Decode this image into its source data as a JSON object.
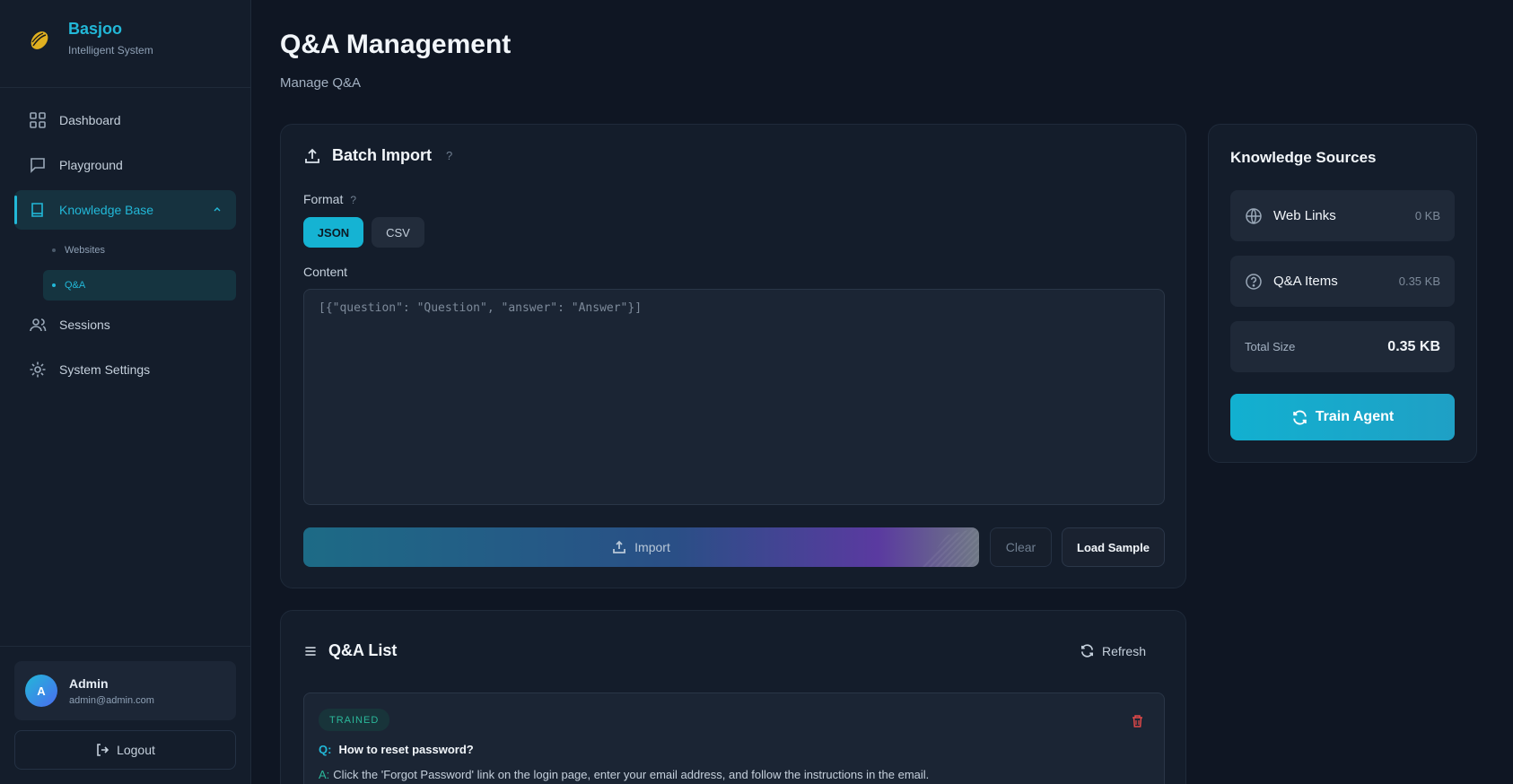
{
  "brand": {
    "name": "Basjoo",
    "subtitle": "Intelligent System"
  },
  "sidebar": {
    "items": [
      {
        "label": "Dashboard",
        "icon": "grid-icon"
      },
      {
        "label": "Playground",
        "icon": "chat-icon"
      },
      {
        "label": "Knowledge Base",
        "icon": "book-icon",
        "active": true,
        "expanded": true,
        "children": [
          {
            "label": "Websites"
          },
          {
            "label": "Q&A",
            "active": true
          }
        ]
      },
      {
        "label": "Sessions",
        "icon": "users-icon"
      },
      {
        "label": "System Settings",
        "icon": "gear-icon"
      }
    ],
    "user": {
      "initial": "A",
      "name": "Admin",
      "email": "admin@admin.com"
    },
    "logout_label": "Logout"
  },
  "page": {
    "title": "Q&A Management",
    "subtitle": "Manage Q&A"
  },
  "batch_import": {
    "title": "Batch Import",
    "help": "?",
    "format_label": "Format",
    "format_help": "?",
    "formats": [
      "JSON",
      "CSV"
    ],
    "selected_format": "JSON",
    "content_label": "Content",
    "content_placeholder": "[{\"question\": \"Question\", \"answer\": \"Answer\"}]",
    "content_value": "",
    "import_label": "Import",
    "clear_label": "Clear",
    "load_sample_label": "Load Sample"
  },
  "qa_list": {
    "title": "Q&A List",
    "refresh_label": "Refresh",
    "items": [
      {
        "status": "TRAINED",
        "q_prefix": "Q:",
        "question": "How to reset password?",
        "a_prefix": "A:",
        "answer": "Click the 'Forgot Password' link on the login page, enter your email address, and follow the instructions in the email."
      }
    ]
  },
  "knowledge_sources": {
    "title": "Knowledge Sources",
    "rows": [
      {
        "label": "Web Links",
        "size": "0 KB",
        "icon": "globe-icon"
      },
      {
        "label": "Q&A Items",
        "size": "0.35 KB",
        "icon": "question-circle-icon"
      }
    ],
    "total_label": "Total Size",
    "total_value": "0.35 KB",
    "train_label": "Train Agent"
  },
  "colors": {
    "accent": "#22b8d8",
    "background": "#0f1623",
    "panel": "#141d2b",
    "success": "#2bb89a",
    "danger": "#e04848"
  }
}
